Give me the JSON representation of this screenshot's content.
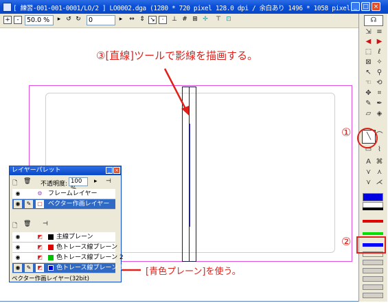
{
  "window": {
    "title": "[ 練習-001-001-0001/LO/2 ] LO0002.dga (1280 * 720 pixel 128.0 dpi / 余白あり 1496 * 1058 pixel)",
    "controls": [
      "_",
      "□",
      "×"
    ]
  },
  "toolbar": {
    "zoom_value": "50.0 %",
    "rotation_value": "0",
    "plus_label": "+",
    "minus_label": "-"
  },
  "annotations": {
    "step3": "③[直線]ツールで影線を描画する。",
    "step1": "①",
    "step2": "②",
    "use_blue_plane": "[青色プレーン]を使う。"
  },
  "palette": {
    "swatches": [
      {
        "name": "blue",
        "color": "#0000e0"
      },
      {
        "name": "white",
        "color": "#ffffff"
      },
      {
        "name": "black",
        "color": "#000000"
      },
      {
        "name": "red",
        "color": "#e00000"
      },
      {
        "name": "green",
        "color": "#00e000"
      },
      {
        "name": "blue-selected",
        "color": "#0000ff"
      }
    ]
  },
  "layer_palette": {
    "title": "レイヤーパレット",
    "opacity_label": "不透明度:",
    "opacity_value": "100 %",
    "layers": [
      {
        "label": "フレームレイヤー",
        "selected": false
      },
      {
        "label": "ベクター作画レイヤー",
        "selected": true
      }
    ],
    "planes": [
      {
        "label": "主線プレーン",
        "color": "#000000",
        "selected": false
      },
      {
        "label": "色トレース線プレーン",
        "color": "#e00000",
        "selected": false
      },
      {
        "label": "色トレース線プレーン 2",
        "color": "#00c000",
        "selected": false
      },
      {
        "label": "色トレース線プレーン 3",
        "color": "#0000e0",
        "selected": true
      }
    ],
    "status": "ベクター作画レイヤー(32bit)"
  }
}
